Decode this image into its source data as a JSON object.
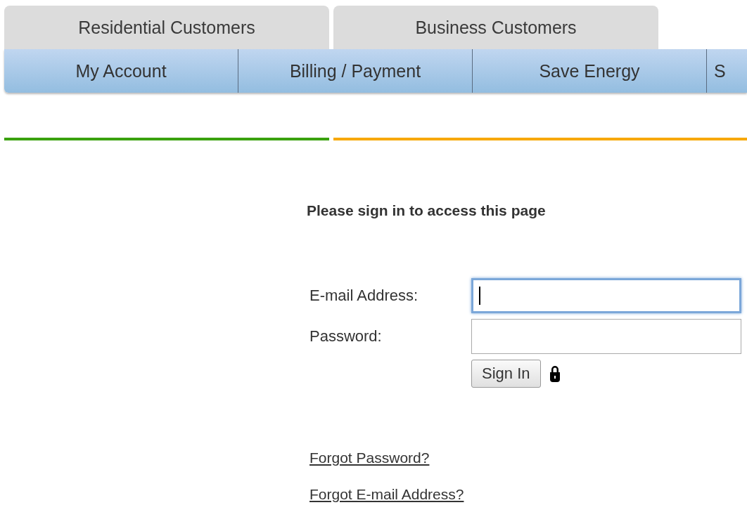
{
  "customer_tabs": [
    {
      "label": "Residential Customers",
      "selected": false
    },
    {
      "label": "Business Customers",
      "selected": false
    }
  ],
  "nav": [
    "My Account",
    "Billing / Payment",
    "Save Energy",
    "S"
  ],
  "heading": "Please sign in to access this page",
  "fields": [
    {
      "label": "E-mail Address:",
      "focused": true
    },
    {
      "label": "Password:",
      "focused": false
    }
  ],
  "button": "Sign In",
  "links": [
    "Forgot Password?",
    "Forgot E-mail Address?"
  ]
}
